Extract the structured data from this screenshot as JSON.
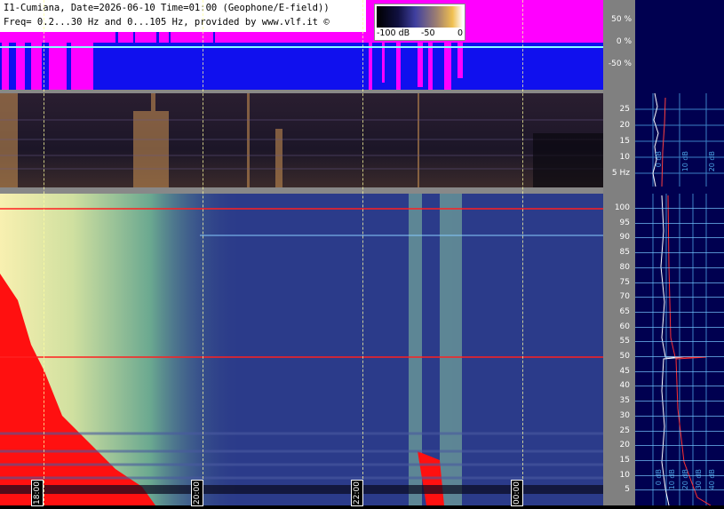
{
  "info": {
    "line1": "I1-Cumiana, Date=2026-06-10 Time=01:00 (Geophone/E-field))",
    "line2": "Freq= 0.2...30 Hz and 0...105 Hz, provided by www.vlf.it ©"
  },
  "colorbar": {
    "min": "-100 dB",
    "mid": "-50",
    "max": "0"
  },
  "top_axis": [
    "50 %",
    "0 %",
    "-50 %"
  ],
  "mid_axis": [
    "25",
    "20",
    "15",
    "10",
    "5 Hz"
  ],
  "bot_axis": [
    "100",
    "95",
    "90",
    "85",
    "80",
    "75",
    "70",
    "65",
    "60",
    "55",
    "50",
    "45",
    "40",
    "35",
    "30",
    "25",
    "20",
    "15",
    "10",
    "5"
  ],
  "time_labels": [
    "18:00",
    "20:00",
    "22:00",
    "00:00"
  ],
  "right_panel": {
    "mid_labels": [
      "0 dB",
      "10 dB",
      "20 dB"
    ],
    "bot_labels": [
      "0 dB",
      "10 dB",
      "20 dB",
      "30 dB",
      "40 dB"
    ]
  },
  "colors": {
    "magenta": "#ff00ff",
    "blue": "#1010ee",
    "spectrogram_bg": "#2b3b8a",
    "red_line": "#ff2020",
    "cyan_grid": "#78c8ff"
  }
}
